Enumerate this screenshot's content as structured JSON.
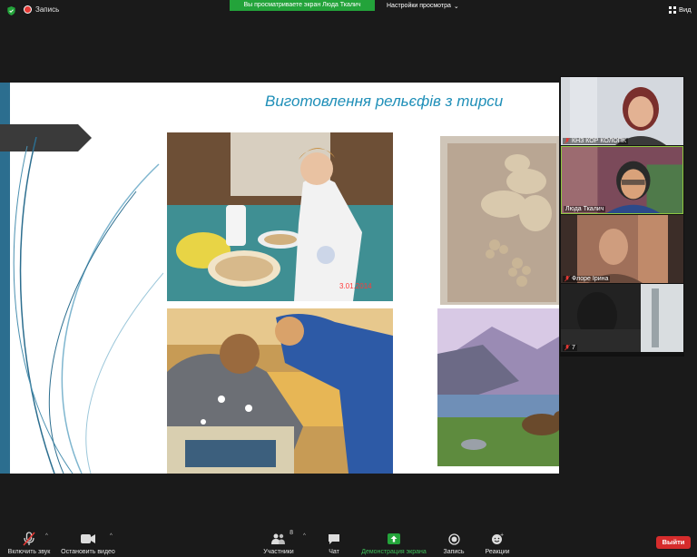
{
  "topbar": {
    "recording_label": "Запись",
    "sharing_banner": "Вы просматриваете экран Люда Ткалич",
    "view_options": "Настройки просмотра",
    "view_button": "Вид"
  },
  "slide": {
    "title": "Виготовлення рельєфів з тирси",
    "photo_date_stamp": "3.01.2014"
  },
  "participants": [
    {
      "name": "КНЗ КОР КОЛОПК",
      "muted": true
    },
    {
      "name": "Люда Ткалич",
      "muted": false
    },
    {
      "name": "Флоре Ірина",
      "muted": true
    },
    {
      "name": "7",
      "muted": true
    }
  ],
  "toolbar": {
    "unmute_label": "Включить звук",
    "stop_video_label": "Остановить видео",
    "participants_label": "Участники",
    "participants_count": "8",
    "chat_label": "Чат",
    "share_screen_label": "Демонстрация экрана",
    "record_label": "Запись",
    "reactions_label": "Реакции",
    "leave_label": "Выйти"
  },
  "colors": {
    "share_green": "#23a33a",
    "leave_red": "#d62c2c",
    "title_blue": "#1f8fb8",
    "slide_accent": "#2c6e8f"
  }
}
